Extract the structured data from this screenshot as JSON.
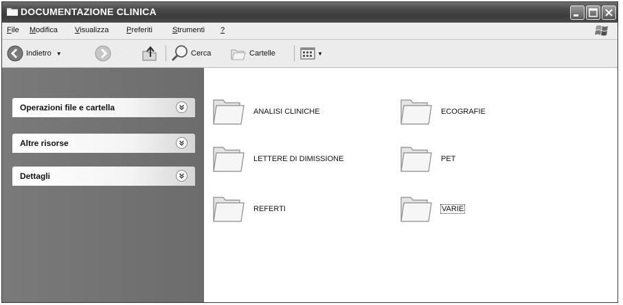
{
  "window": {
    "title": "DOCUMENTAZIONE CLINICA"
  },
  "menu": [
    {
      "label": "File",
      "accel": "F",
      "rest": "ile"
    },
    {
      "label": "Modifica",
      "accel": "M",
      "rest": "odifica"
    },
    {
      "label": "Visualizza",
      "accel": "V",
      "rest": "isualizza"
    },
    {
      "label": "Preferiti",
      "accel": "P",
      "rest": "referiti"
    },
    {
      "label": "Strumenti",
      "accel": "S",
      "rest": "trumenti"
    },
    {
      "label": "?",
      "accel": "?",
      "rest": ""
    }
  ],
  "toolbar": {
    "back_label": "Indietro",
    "search_label": "Cerca",
    "folders_label": "Cartelle"
  },
  "tasks": [
    {
      "label": "Operazioni file e cartella"
    },
    {
      "label": "Altre risorse"
    },
    {
      "label": "Dettagli"
    }
  ],
  "folders": [
    {
      "name": "ANALISI CLINICHE"
    },
    {
      "name": "ECOGRAFIE"
    },
    {
      "name": "LETTERE DI DIMISSIONE"
    },
    {
      "name": "PET"
    },
    {
      "name": "REFERTI"
    },
    {
      "name": "VARIE",
      "selected": true
    }
  ],
  "icons": {
    "title": "folder-icon",
    "back": "back-arrow-icon",
    "forward": "forward-arrow-icon",
    "up": "up-folder-icon",
    "search": "search-icon",
    "folders": "folders-icon",
    "views": "views-icon",
    "task_toggle": "chevron-double-down-icon"
  }
}
